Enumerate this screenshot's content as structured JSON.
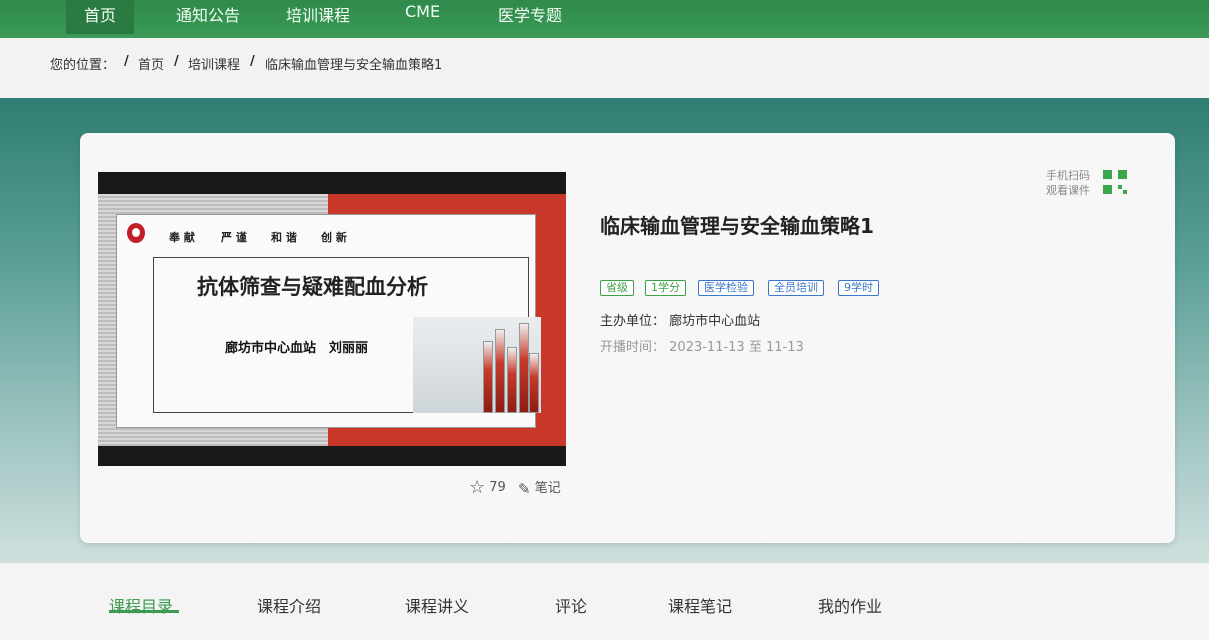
{
  "nav": {
    "items": [
      "首页",
      "通知公告",
      "培训课程",
      "CME",
      "医学专题"
    ]
  },
  "breadcrumb": {
    "label": "您的位置：",
    "sep": "/",
    "items": [
      "首页",
      "培训课程",
      "临床输血管理与安全输血策略1"
    ]
  },
  "slide": {
    "motto": [
      "奉 献",
      "严 谨",
      "和 谐",
      "创 新"
    ],
    "title": "抗体筛查与疑难配血分析",
    "author": "廊坊市中心血站　刘丽丽"
  },
  "actions": {
    "favorite_count": "79",
    "note_label": "笔记"
  },
  "course": {
    "title": "临床输血管理与安全输血策略1",
    "tags": [
      "省级",
      "1学分",
      "医学检验",
      "全员培训",
      "9学时"
    ],
    "host_label": "主办单位：",
    "host": "廊坊市中心血站",
    "time_label": "开播时间：",
    "time": "2023-11-13 至 11-13"
  },
  "qr": {
    "line1": "手机扫码",
    "line2": "观看课件"
  },
  "tabs": [
    "课程目录",
    "课程介绍",
    "课程讲义",
    "评论",
    "课程笔记",
    "我的作业"
  ],
  "colors": {
    "brand_green": "#3a9a56",
    "tag_green": "#3ca24a",
    "tag_blue": "#3b78c9"
  }
}
